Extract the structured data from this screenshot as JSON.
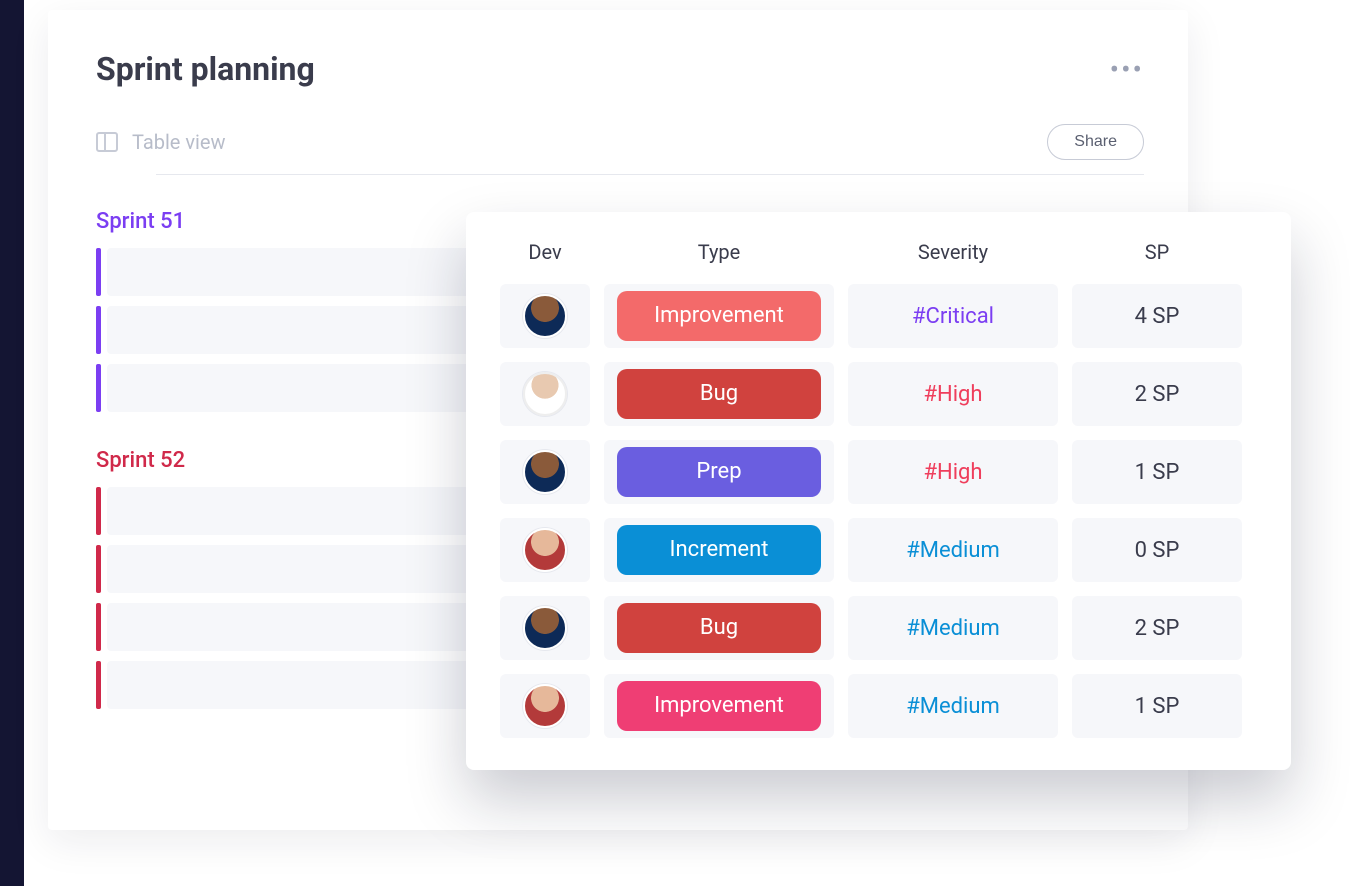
{
  "header": {
    "title": "Sprint planning",
    "view_label": "Table view",
    "share_label": "Share"
  },
  "sprints": [
    {
      "title": "Sprint 51",
      "color": "purple",
      "rows": 3
    },
    {
      "title": "Sprint 52",
      "color": "crimson",
      "rows": 4
    }
  ],
  "table": {
    "columns": [
      "Dev",
      "Type",
      "Severity",
      "SP"
    ],
    "rows": [
      {
        "avatar": "a1",
        "type": "Improvement",
        "type_color": "pill-salmon",
        "severity": "#Critical",
        "sev_color": "purple",
        "sp": "4 SP"
      },
      {
        "avatar": "a2",
        "type": "Bug",
        "type_color": "pill-red",
        "severity": "#High",
        "sev_color": "red",
        "sp": "2 SP"
      },
      {
        "avatar": "a1",
        "type": "Prep",
        "type_color": "pill-violet",
        "severity": "#High",
        "sev_color": "red",
        "sp": "1 SP"
      },
      {
        "avatar": "a3",
        "type": "Increment",
        "type_color": "pill-blue",
        "severity": "#Medium",
        "sev_color": "blue",
        "sp": "0 SP"
      },
      {
        "avatar": "a1",
        "type": "Bug",
        "type_color": "pill-red",
        "severity": "#Medium",
        "sev_color": "blue",
        "sp": "2 SP"
      },
      {
        "avatar": "a3",
        "type": "Improvement",
        "type_color": "pill-pink",
        "severity": "#Medium",
        "sev_color": "blue",
        "sp": "1 SP"
      }
    ]
  }
}
